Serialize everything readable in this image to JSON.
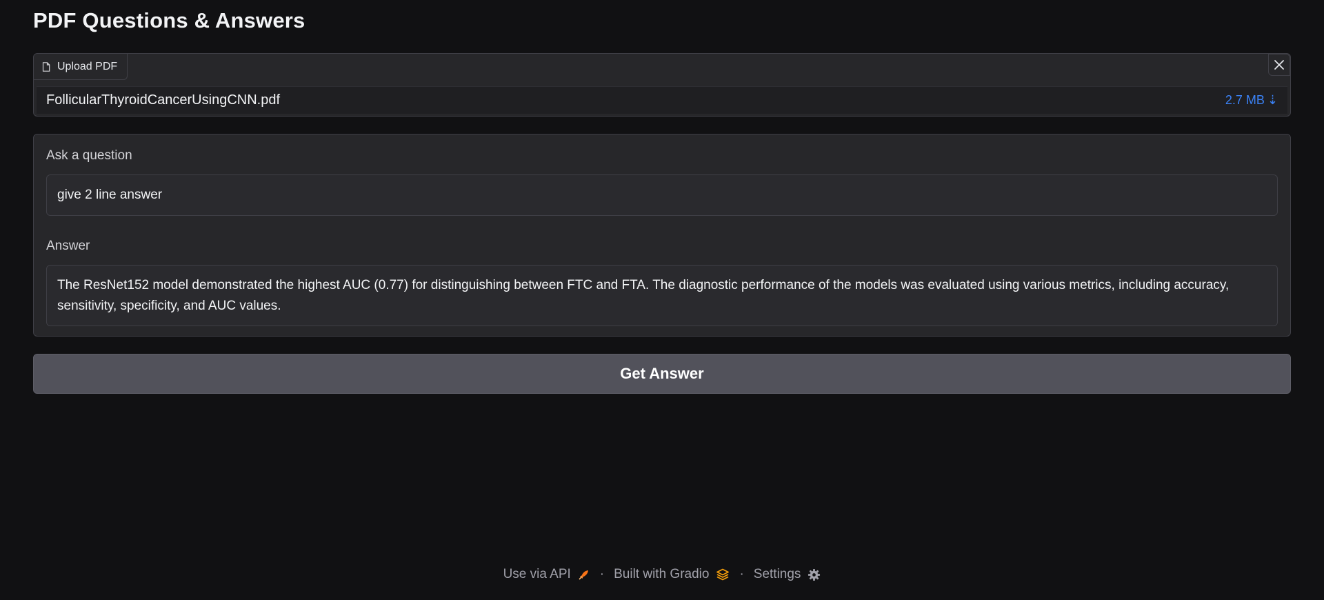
{
  "title": "PDF Questions & Answers",
  "upload": {
    "label": "Upload PDF",
    "file_name": "FollicularThyroidCancerUsingCNN.pdf",
    "file_size": "2.7 MB",
    "download_glyph": "⇣"
  },
  "question": {
    "label": "Ask a question",
    "value": "give 2 line answer"
  },
  "answer": {
    "label": "Answer",
    "text": "The ResNet152 model demonstrated the highest AUC (0.77) for distinguishing between FTC and FTA. The diagnostic performance of the models was evaluated using various metrics, including accuracy, sensitivity, specificity, and AUC values."
  },
  "button": {
    "label": "Get Answer"
  },
  "footer": {
    "api": "Use via API",
    "built": "Built with Gradio",
    "settings": "Settings",
    "separator": "·"
  },
  "colors": {
    "background": "#111113",
    "panel": "#27272a",
    "button": "#52525b",
    "link": "#3b82f6",
    "gradio_orange": "#f97316"
  },
  "icons": [
    "file-icon",
    "close-icon",
    "rocket-icon",
    "gradio-logo-icon",
    "gear-icon"
  ]
}
